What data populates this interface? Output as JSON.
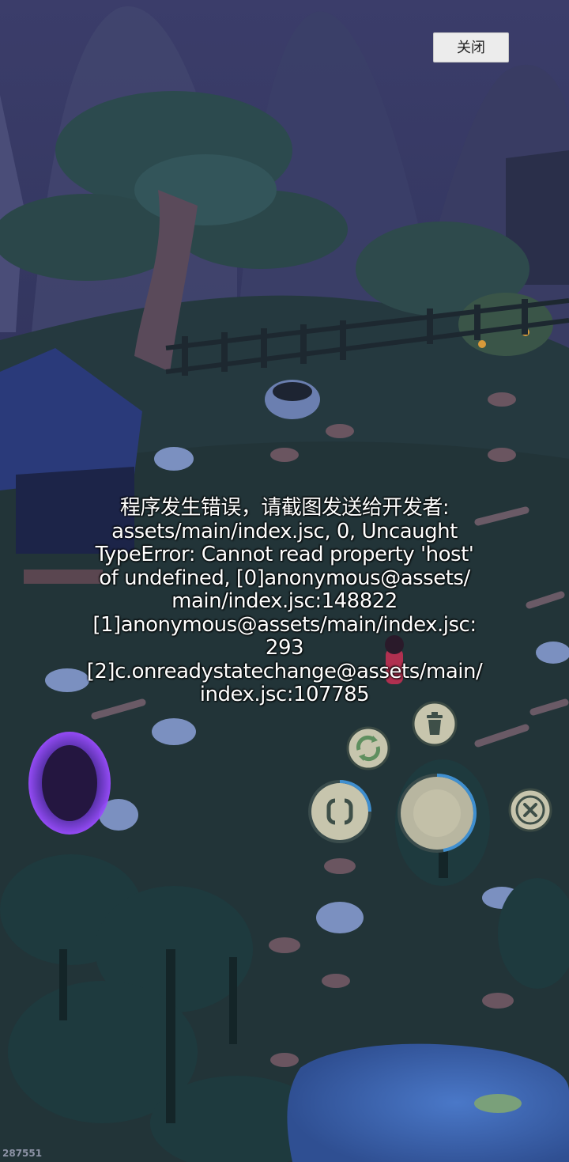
{
  "dialog": {
    "close_label": "关闭"
  },
  "error": {
    "lines": [
      "程序发生错误，请截图发送给开发者:",
      "assets/main/index.jsc, 0, Uncaught",
      "TypeError: Cannot read property 'host'",
      "of undefined, [0]anonymous@assets/",
      "main/index.jsc:148822",
      "[1]anonymous@assets/main/index.jsc:",
      "293",
      "[2]c.onreadystatechange@assets/main/",
      "index.jsc:107785"
    ]
  },
  "corner_counter": "287551",
  "controls": {
    "icons": [
      "refresh-icon",
      "trash-icon",
      "rotate-icon",
      "joystick",
      "close-icon"
    ]
  },
  "colors": {
    "night_sky": "#2b2f55",
    "foliage": "#2e4a50",
    "water": "#3a5fb0",
    "portal": "#8a3cff",
    "button_face": "#c9c8b0"
  }
}
